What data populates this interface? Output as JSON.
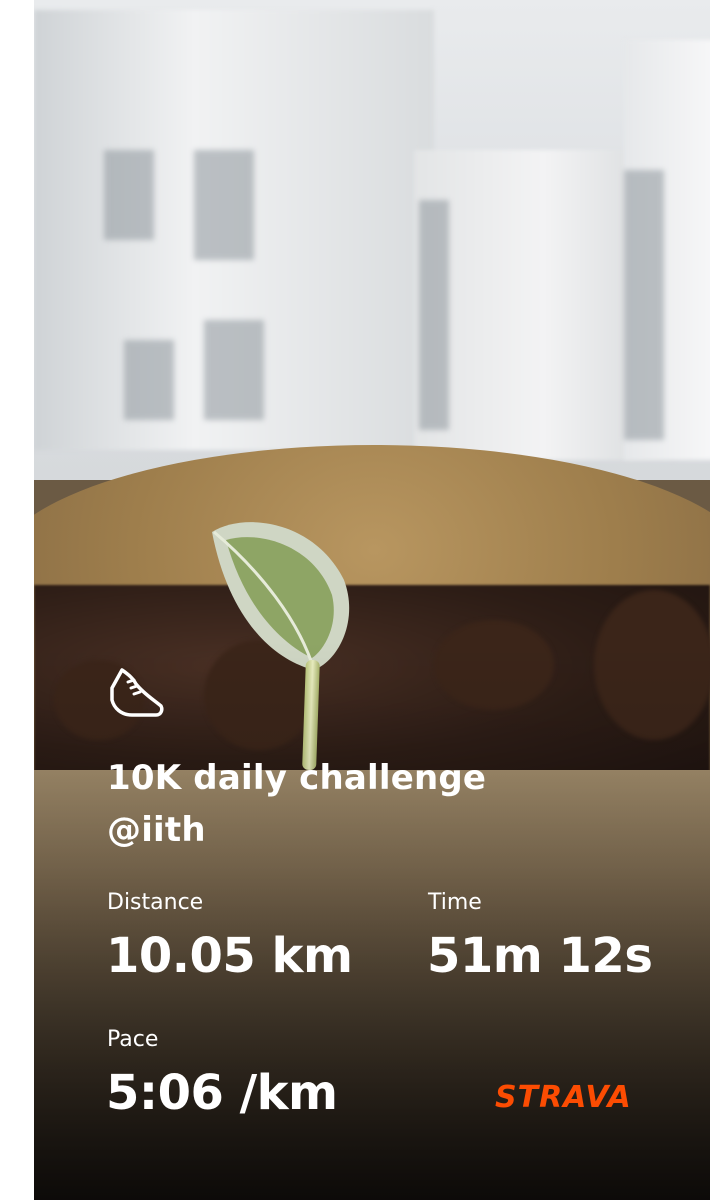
{
  "activity": {
    "icon": "running-shoe-icon",
    "title_line1": "10K daily challenge",
    "title_line2": "@iith"
  },
  "stats": {
    "distance": {
      "label": "Distance",
      "value": "10.05 km"
    },
    "time": {
      "label": "Time",
      "value": "51m 12s"
    },
    "pace": {
      "label": "Pace",
      "value": "5:06 /km"
    }
  },
  "brand": {
    "name": "STRAVA",
    "color": "#fc4c02"
  }
}
